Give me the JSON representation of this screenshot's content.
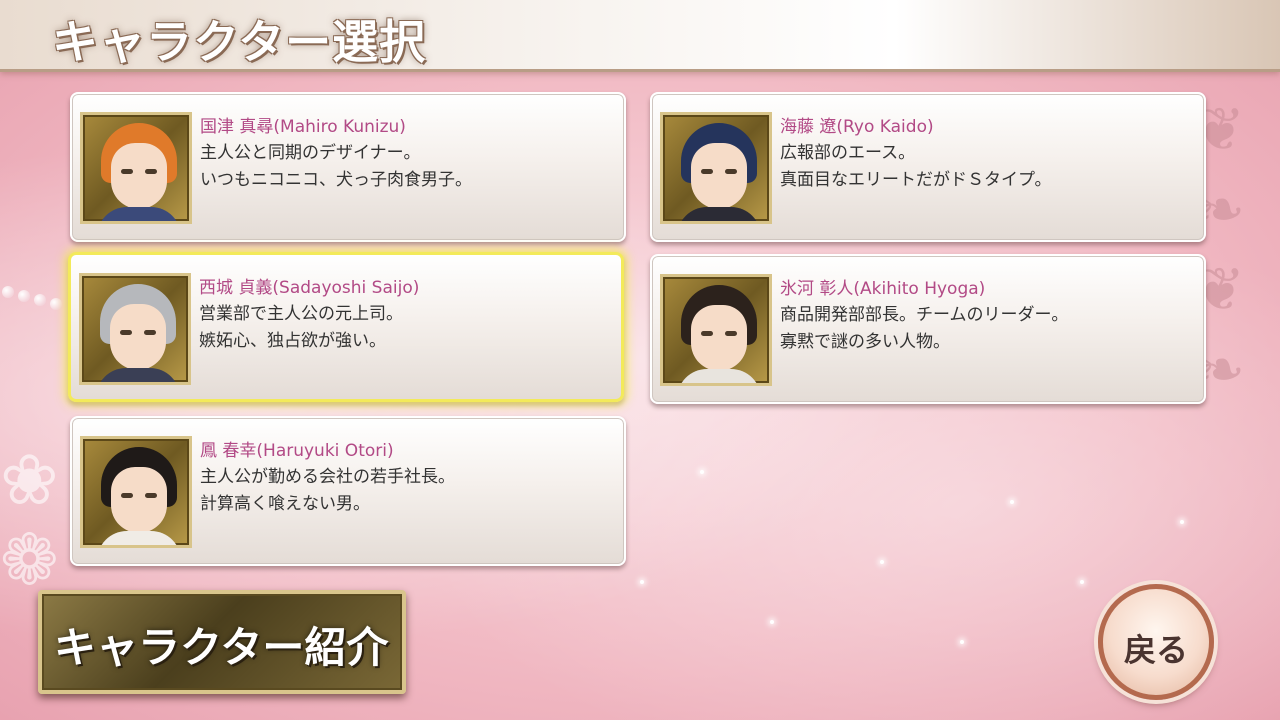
{
  "header": {
    "title": "キャラクター選択"
  },
  "characters": [
    {
      "name": "国津 真尋(Mahiro Kunizu)",
      "line1": "主人公と同期のデザイナー。",
      "line2": "いつもニコニコ、犬っ子肉食男子。",
      "hair": "#e07a2a",
      "shirt": "#3b4a7a",
      "selected": false
    },
    {
      "name": "海藤 遼(Ryo Kaido)",
      "line1": "広報部のエース。",
      "line2": "真面目なエリートだがドＳタイプ。",
      "hair": "#25345c",
      "shirt": "#2b2b35",
      "selected": false
    },
    {
      "name": "西城 貞義(Sadayoshi Saijo)",
      "line1": "営業部で主人公の元上司。",
      "line2": "嫉妬心、独占欲が強い。",
      "hair": "#b6b8bc",
      "shirt": "#3a3f55",
      "selected": true
    },
    {
      "name": "氷河 彰人(Akihito Hyoga)",
      "line1": "商品開発部部長。チームのリーダー。",
      "line2": "寡黙で謎の多い人物。",
      "hair": "#2c221c",
      "shirt": "#e8e4de",
      "selected": false
    },
    {
      "name": "鳳 春幸(Haruyuki Otori)",
      "line1": "主人公が勤める会社の若手社長。",
      "line2": "計算高く喰えない男。",
      "hair": "#1f1a18",
      "shirt": "#f0ece6",
      "selected": false
    }
  ],
  "buttons": {
    "character_intro": "キャラクター紹介",
    "back": "戻る"
  },
  "colors": {
    "name_text": "#b24a86",
    "selected_glow": "#f3ea5a",
    "background_pink": "#f1b9c3"
  }
}
